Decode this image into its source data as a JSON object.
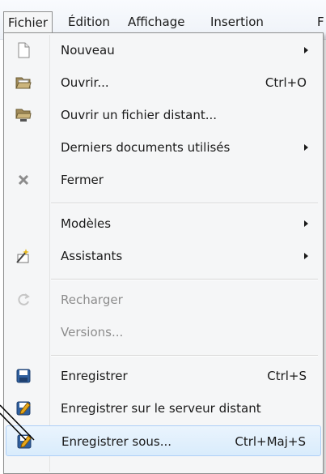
{
  "menubar": {
    "items": [
      "Fichier",
      "Édition",
      "Affichage",
      "Insertion",
      "F"
    ]
  },
  "menu": {
    "items": [
      {
        "label": "Nouveau",
        "icon": "new-document-icon",
        "submenu": true
      },
      {
        "label": "Ouvrir...",
        "icon": "open-folder-icon",
        "shortcut": "Ctrl+O"
      },
      {
        "label": "Ouvrir un fichier distant...",
        "icon": "remote-folder-icon"
      },
      {
        "label": "Derniers documents utilisés",
        "submenu": true
      },
      {
        "label": "Fermer",
        "icon": "close-icon"
      },
      {
        "label": "Modèles",
        "submenu": true
      },
      {
        "label": "Assistants",
        "icon": "wizard-icon",
        "submenu": true
      },
      {
        "label": "Recharger",
        "icon": "reload-icon",
        "disabled": true
      },
      {
        "label": "Versions...",
        "disabled": true
      },
      {
        "label": "Enregistrer",
        "icon": "save-icon",
        "shortcut": "Ctrl+S"
      },
      {
        "label": "Enregistrer sur le serveur distant",
        "icon": "save-remote-icon"
      },
      {
        "label": "Enregistrer sous...",
        "icon": "save-as-icon",
        "shortcut": "Ctrl+Maj+S",
        "highlighted": true
      }
    ]
  },
  "colors": {
    "highlight_border": "#aecff7",
    "menu_background": "#f5f6f7",
    "save_icon_blue": "#2f5f9e"
  }
}
